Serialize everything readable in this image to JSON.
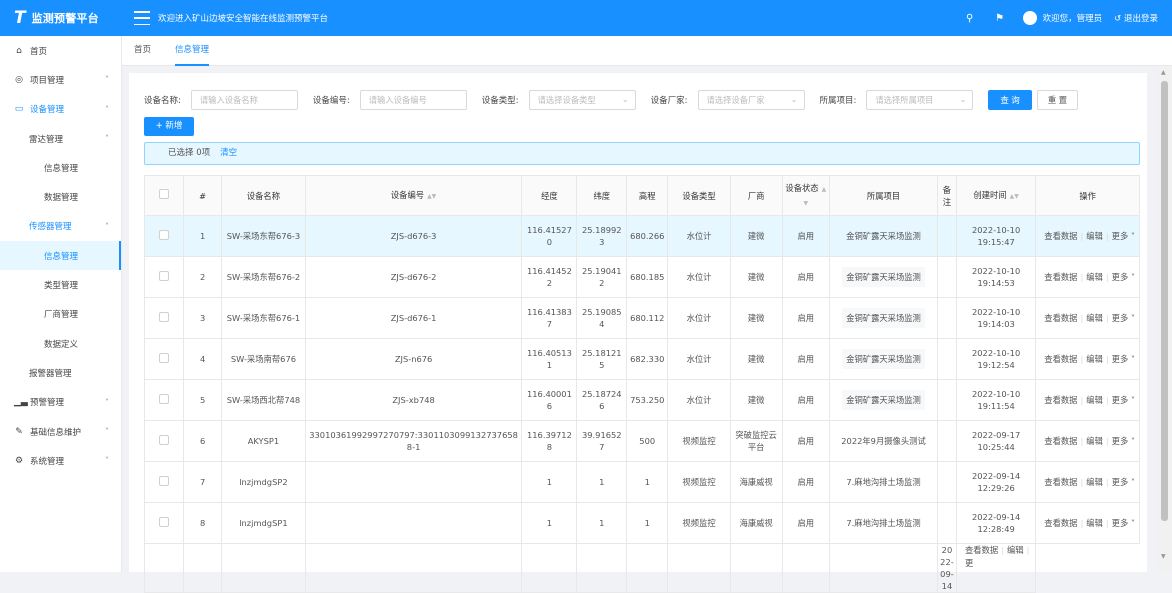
{
  "header": {
    "logo_glyph": "T",
    "app_title": "监测预警平台",
    "welcome_text": "欢迎进入矿山边坡安全智能在线监测预警平台",
    "greeting": "欢迎您，管理员",
    "logout_label": "退出登录"
  },
  "sidebar": {
    "items": [
      {
        "label": "首页",
        "icon": "home-icon",
        "level": 1
      },
      {
        "label": "项目管理",
        "icon": "globe-icon",
        "level": 1,
        "chevron": "down"
      },
      {
        "label": "设备管理",
        "icon": "monitor-icon",
        "level": 1,
        "chevron": "up",
        "state": "expanded"
      },
      {
        "label": "雷达管理",
        "level": 2,
        "chevron": "up"
      },
      {
        "label": "信息管理",
        "level": 3
      },
      {
        "label": "数据管理",
        "level": 3
      },
      {
        "label": "传感器管理",
        "level": 2,
        "chevron": "up",
        "state": "expanded"
      },
      {
        "label": "信息管理",
        "level": 3,
        "state": "active"
      },
      {
        "label": "类型管理",
        "level": 3
      },
      {
        "label": "厂商管理",
        "level": 3
      },
      {
        "label": "数据定义",
        "level": 3
      },
      {
        "label": "报警器管理",
        "level": 2
      },
      {
        "label": "预警管理",
        "icon": "chart-icon",
        "level": 1,
        "chevron": "down"
      },
      {
        "label": "基础信息维护",
        "icon": "edit-icon",
        "level": 1,
        "chevron": "down"
      },
      {
        "label": "系统管理",
        "icon": "gear-icon",
        "level": 1,
        "chevron": "down"
      }
    ]
  },
  "tabs": [
    {
      "label": "首页",
      "active": false
    },
    {
      "label": "信息管理",
      "active": true
    }
  ],
  "filters": {
    "name_label": "设备名称:",
    "name_placeholder": "请输入设备名称",
    "code_label": "设备编号:",
    "code_placeholder": "请输入设备编号",
    "type_label": "设备类型:",
    "type_placeholder": "请选择设备类型",
    "vendor_label": "设备厂家:",
    "vendor_placeholder": "请选择设备厂家",
    "project_label": "所属项目:",
    "project_placeholder": "请选择所属项目",
    "query_label": "查 询",
    "reset_label": "重 置"
  },
  "add_label": "新增",
  "selection": {
    "text": "已选择 0项",
    "clear_label": "清空"
  },
  "table": {
    "columns": [
      "#",
      "设备名称",
      "设备编号",
      "经度",
      "纬度",
      "高程",
      "设备类型",
      "厂商",
      "设备状态",
      "所属项目",
      "备注",
      "创建时间",
      "操作"
    ],
    "op_view": "查看数据",
    "op_edit": "编辑",
    "op_more": "更多",
    "rows": [
      {
        "idx": "1",
        "name": "SW-采场东帮676-3",
        "code": "ZJS-d676-3",
        "lng": "116.415270",
        "lat": "25.189923",
        "elev": "680.266",
        "type": "水位计",
        "vendor": "建微",
        "status": "启用",
        "project": "金铜矿露天采场监测",
        "remark": "",
        "date": "2022-10-10",
        "time": "19:15:47"
      },
      {
        "idx": "2",
        "name": "SW-采场东帮676-2",
        "code": "ZJS-d676-2",
        "lng": "116.414522",
        "lat": "25.190412",
        "elev": "680.185",
        "type": "水位计",
        "vendor": "建微",
        "status": "启用",
        "project": "金铜矿露天采场监测",
        "remark": "",
        "date": "2022-10-10",
        "time": "19:14:53"
      },
      {
        "idx": "3",
        "name": "SW-采场东帮676-1",
        "code": "ZJS-d676-1",
        "lng": "116.413837",
        "lat": "25.190854",
        "elev": "680.112",
        "type": "水位计",
        "vendor": "建微",
        "status": "启用",
        "project": "金铜矿露天采场监测",
        "remark": "",
        "date": "2022-10-10",
        "time": "19:14:03"
      },
      {
        "idx": "4",
        "name": "SW-采场南帮676",
        "code": "ZJS-n676",
        "lng": "116.405131",
        "lat": "25.181215",
        "elev": "682.330",
        "type": "水位计",
        "vendor": "建微",
        "status": "启用",
        "project": "金铜矿露天采场监测",
        "remark": "",
        "date": "2022-10-10",
        "time": "19:12:54"
      },
      {
        "idx": "5",
        "name": "SW-采场西北帮748",
        "code": "ZJS-xb748",
        "lng": "116.400016",
        "lat": "25.187246",
        "elev": "753.250",
        "type": "水位计",
        "vendor": "建微",
        "status": "启用",
        "project": "金铜矿露天采场监测",
        "remark": "",
        "date": "2022-10-10",
        "time": "19:11:54"
      },
      {
        "idx": "6",
        "name": "AKYSP1",
        "code": "33010361992997270797:33011030991327376588-1",
        "lng": "116.397128",
        "lat": "39.916527",
        "elev": "500",
        "type": "视频监控",
        "vendor": "突破监控云平台",
        "status": "启用",
        "project": "2022年9月摄像头测试",
        "remark": "",
        "date": "2022-09-17",
        "time": "10:25:44"
      },
      {
        "idx": "7",
        "name": "lnzjmdgSP2",
        "code": "",
        "lng": "1",
        "lat": "1",
        "elev": "1",
        "type": "视频监控",
        "vendor": "海康威视",
        "status": "启用",
        "project": "7.麻地沟排土场监测",
        "remark": "",
        "date": "2022-09-14",
        "time": "12:29:26"
      },
      {
        "idx": "8",
        "name": "lnzjmdgSP1",
        "code": "",
        "lng": "1",
        "lat": "1",
        "elev": "1",
        "type": "视频监控",
        "vendor": "海康威视",
        "status": "启用",
        "project": "7.麻地沟排土场监测",
        "remark": "",
        "date": "2022-09-14",
        "time": "12:28:49"
      }
    ],
    "partial_row": {
      "date": "2022-09-14",
      "op_view": "查看数据",
      "op_edit": "编辑",
      "op_more": "更"
    }
  }
}
